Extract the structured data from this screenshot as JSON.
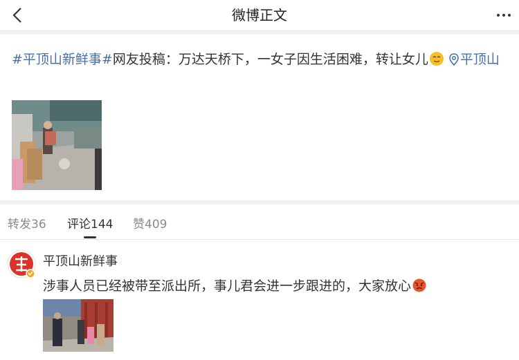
{
  "nav": {
    "title": "微博正文",
    "back_icon": "chevron-left-icon",
    "more_icon": "more-dots-icon"
  },
  "post": {
    "topic": "#平顶山新鲜事#",
    "text": "网友投稿：万达天桥下，一女子因生活困难，转让女儿",
    "emoji": "dizzy-face-emoji",
    "location": "平顶山"
  },
  "tabs": {
    "repost": "转发36",
    "comment": "评论144",
    "like": "赞409"
  },
  "comment": {
    "username": "平顶山新鲜事",
    "text": "涉事人员已经被带至派出所，事儿君会进一步跟进的，大家放心",
    "emoji": "angry-face-emoji"
  },
  "colors": {
    "link": "#4a6ea8",
    "verified_badge": "#f5a623",
    "avatar_red": "#d9342b"
  }
}
